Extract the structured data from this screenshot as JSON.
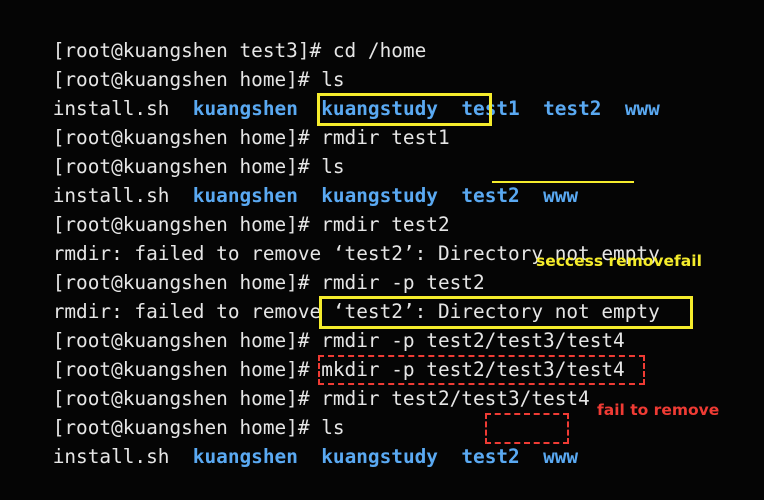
{
  "terminal": {
    "lines": [
      [
        {
          "t": "[root@kuangshen test3]# cd /home",
          "k": "text"
        }
      ],
      [
        {
          "t": "[root@kuangshen home]# ls",
          "k": "text"
        }
      ],
      [
        {
          "t": "install.sh  ",
          "k": "text"
        },
        {
          "t": "kuangshen",
          "k": "dir"
        },
        {
          "t": "  ",
          "k": "text"
        },
        {
          "t": "kuangstudy",
          "k": "dir"
        },
        {
          "t": "  ",
          "k": "text"
        },
        {
          "t": "test1",
          "k": "dir"
        },
        {
          "t": "  ",
          "k": "text"
        },
        {
          "t": "test2",
          "k": "dir"
        },
        {
          "t": "  ",
          "k": "text"
        },
        {
          "t": "www",
          "k": "dir"
        }
      ],
      [
        {
          "t": "[root@kuangshen home]# rmdir test1",
          "k": "text"
        }
      ],
      [
        {
          "t": "[root@kuangshen home]# ls",
          "k": "text"
        }
      ],
      [
        {
          "t": "install.sh  ",
          "k": "text"
        },
        {
          "t": "kuangshen",
          "k": "dir"
        },
        {
          "t": "  ",
          "k": "text"
        },
        {
          "t": "kuangstudy",
          "k": "dir"
        },
        {
          "t": "  ",
          "k": "text"
        },
        {
          "t": "test2",
          "k": "dir"
        },
        {
          "t": "  ",
          "k": "text"
        },
        {
          "t": "www",
          "k": "dir"
        }
      ],
      [
        {
          "t": "[root@kuangshen home]# rmdir test2",
          "k": "text"
        }
      ],
      [
        {
          "t": "rmdir: failed to remove ‘test2’: Directory not empty",
          "k": "text"
        }
      ],
      [
        {
          "t": "[root@kuangshen home]# rmdir -p test2",
          "k": "text"
        }
      ],
      [
        {
          "t": "rmdir: failed to remove ‘test2’: Directory not empty",
          "k": "text"
        }
      ],
      [
        {
          "t": "[root@kuangshen home]# rmdir -p test2/test3/test4",
          "k": "text"
        }
      ],
      [
        {
          "t": "[root@kuangshen home]# mkdir -p test2/test3/test4",
          "k": "text"
        }
      ],
      [
        {
          "t": "[root@kuangshen home]# rmdir test2/test3/test4",
          "k": "text"
        }
      ],
      [
        {
          "t": "[root@kuangshen home]# ls",
          "k": "text"
        }
      ],
      [
        {
          "t": "install.sh  ",
          "k": "text"
        },
        {
          "t": "kuangshen",
          "k": "dir"
        },
        {
          "t": "  ",
          "k": "text"
        },
        {
          "t": "kuangstudy",
          "k": "dir"
        },
        {
          "t": "  ",
          "k": "text"
        },
        {
          "t": "test2",
          "k": "dir"
        },
        {
          "t": "  ",
          "k": "text"
        },
        {
          "t": "www",
          "k": "dir"
        }
      ]
    ]
  },
  "annotations": {
    "success_note": "seccess removefail",
    "fail_note": "fail to remove"
  },
  "colors": {
    "background": "#050505",
    "text": "#e6e6e6",
    "directory": "#5aa9f2",
    "highlight_yellow": "#f5ec2c",
    "highlight_red": "#ef3b34"
  }
}
